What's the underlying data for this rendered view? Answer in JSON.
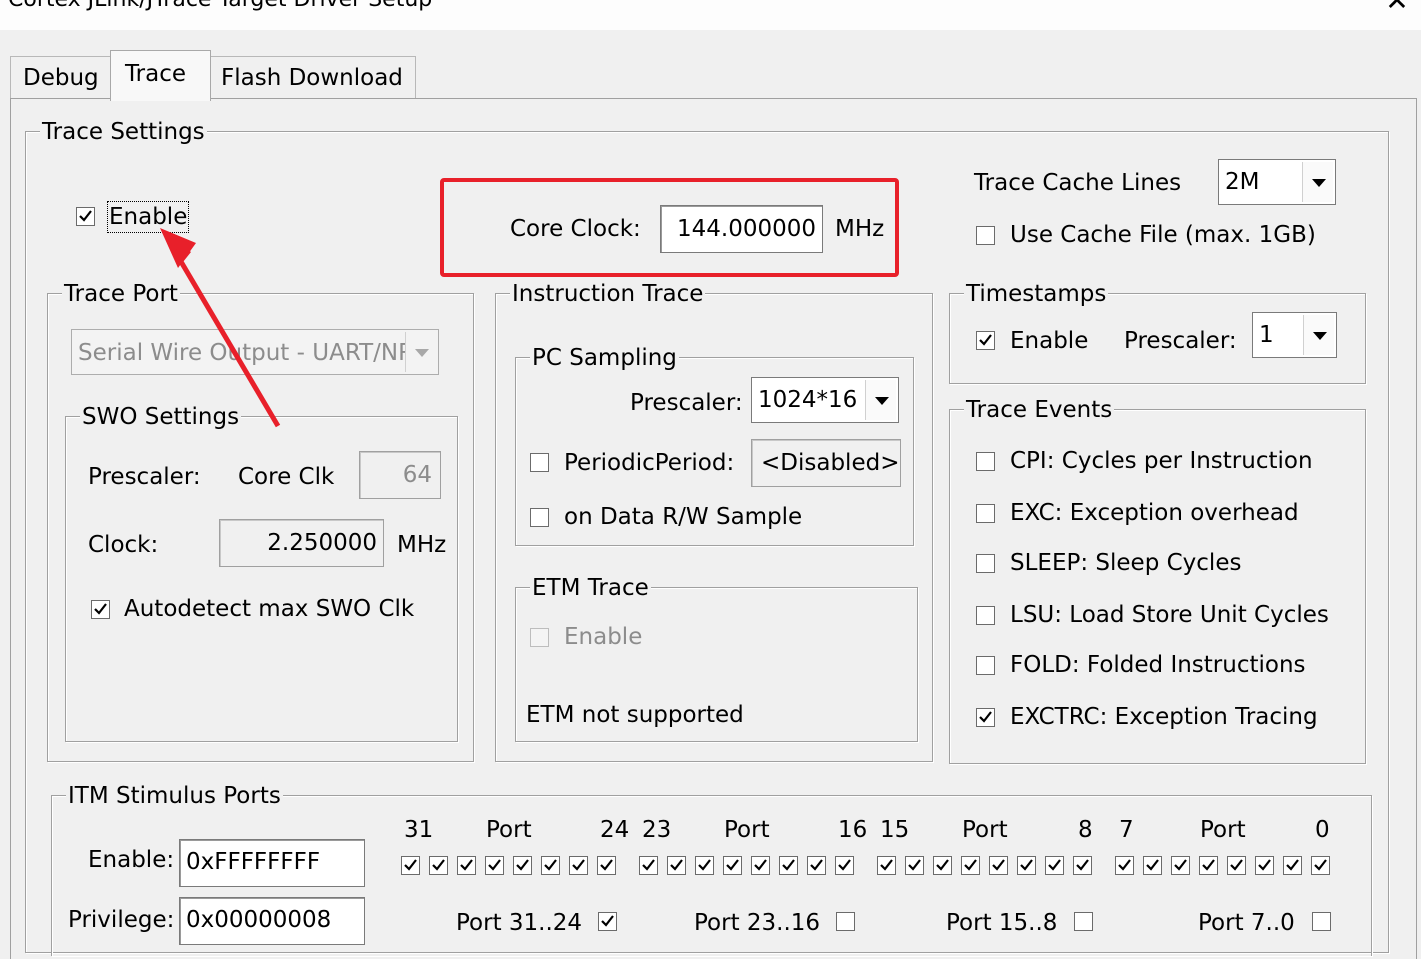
{
  "window": {
    "title": "Cortex JLink/JTrace Target Driver Setup"
  },
  "tabs": [
    {
      "label": "Debug"
    },
    {
      "label": "Trace"
    },
    {
      "label": "Flash Download"
    }
  ],
  "trace_settings": {
    "legend": "Trace Settings",
    "enable": {
      "label": "Enable",
      "checked": true
    },
    "core_clock": {
      "label": "Core Clock:",
      "value": "144.000000",
      "unit": "MHz"
    },
    "cache_lines": {
      "label": "Trace Cache Lines",
      "value": "2M"
    },
    "use_cache_file": {
      "label": "Use Cache File (max. 1GB)",
      "checked": false
    }
  },
  "trace_port": {
    "legend": "Trace Port",
    "port_select": "Serial Wire Output - UART/NRZ",
    "swo": {
      "legend": "SWO Settings",
      "prescaler_label": "Prescaler:",
      "core_clk_label": "Core Clk",
      "prescaler_value": "64",
      "clock_label": "Clock:",
      "clock_value": "2.250000",
      "clock_unit": "MHz",
      "autodetect": {
        "label": "Autodetect max SWO Clk",
        "checked": true
      }
    }
  },
  "instruction_trace": {
    "legend": "Instruction Trace",
    "pc_sampling": {
      "legend": "PC Sampling",
      "prescaler_label": "Prescaler:",
      "prescaler_value": "1024*16",
      "periodic": {
        "label": "PeriodicPeriod:",
        "checked": false,
        "value": "<Disabled>"
      },
      "on_data": {
        "label": "on Data R/W Sample",
        "checked": false
      }
    },
    "etm": {
      "legend": "ETM Trace",
      "enable": {
        "label": "Enable",
        "checked": false
      },
      "note": "ETM not supported"
    }
  },
  "timestamps": {
    "legend": "Timestamps",
    "enable": {
      "label": "Enable",
      "checked": true
    },
    "prescaler_label": "Prescaler:",
    "prescaler_value": "1"
  },
  "trace_events": {
    "legend": "Trace Events",
    "items": [
      {
        "label": "CPI: Cycles per Instruction",
        "checked": false
      },
      {
        "label": "EXC: Exception overhead",
        "checked": false
      },
      {
        "label": "SLEEP: Sleep Cycles",
        "checked": false
      },
      {
        "label": "LSU: Load Store Unit Cycles",
        "checked": false
      },
      {
        "label": "FOLD: Folded Instructions",
        "checked": false
      },
      {
        "label": "EXCTRC: Exception Tracing",
        "checked": true
      }
    ]
  },
  "itm": {
    "legend": "ITM Stimulus Ports",
    "enable_label": "Enable:",
    "enable_value": "0xFFFFFFFF",
    "privilege_label": "Privilege:",
    "privilege_value": "0x00000008",
    "groups": [
      {
        "hi": "31",
        "word": "Port",
        "lo": "24",
        "priv_label": "Port 31..24",
        "priv_checked": true
      },
      {
        "hi": "23",
        "word": "Port",
        "lo": "16",
        "priv_label": "Port 23..16",
        "priv_checked": false
      },
      {
        "hi": "15",
        "word": "Port",
        "lo": "8",
        "priv_label": "Port 15..8",
        "priv_checked": false
      },
      {
        "hi": "7",
        "word": "Port",
        "lo": "0",
        "priv_label": "Port 7..0",
        "priv_checked": false
      }
    ],
    "port_bits_checked": true
  },
  "annotation": {
    "highlight_color": "#e8202a",
    "arrow_color": "#e8202a"
  }
}
